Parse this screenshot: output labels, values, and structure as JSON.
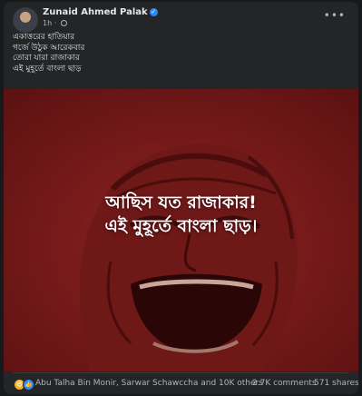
{
  "post": {
    "author": "Zunaid Ahmed Palak",
    "time": "1h",
    "more_icon": "more-horizontal-icon",
    "caption_lines": [
      "একাত্তরের হাতিয়ার",
      "গর্জে উঠুক আরেকবার",
      "তোরা যারা রাজাকার",
      "এই মুহূর্তে বাংলা ছাড়"
    ],
    "image_text": [
      "আছিস যত রাজাকার!",
      "এই মুহূর্তে বাংলা ছাড়।"
    ],
    "reactions": {
      "icons": [
        "haha-icon",
        "like-icon"
      ],
      "names": "Abu Talha Bin Monir, Sarwar Schawccha and 10K others"
    },
    "comments": "2.7K comments",
    "shares": "571 shares"
  },
  "colors": {
    "background": "#18191a",
    "card": "#242526",
    "image_red": "#8a1f1f",
    "link_blue": "#2d88ff"
  }
}
